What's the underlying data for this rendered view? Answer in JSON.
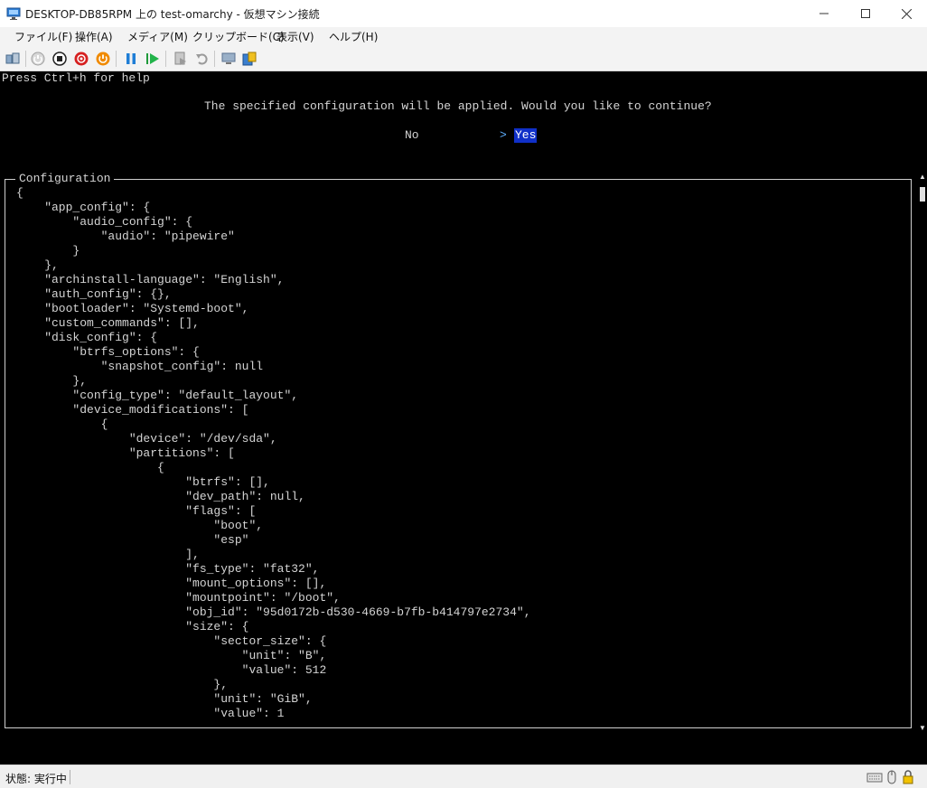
{
  "window": {
    "title": "DESKTOP-DB85RPM 上の test-omarchy  - 仮想マシン接続",
    "minimize_icon": "minimize-icon",
    "maximize_icon": "maximize-icon",
    "close_icon": "close-icon"
  },
  "menu": {
    "items": [
      "ファイル(F)",
      "操作(A)",
      "メディア(M)",
      "クリップボード(C)",
      "表示(V)",
      "ヘルプ(H)"
    ]
  },
  "toolbar": {
    "icons": [
      "ctrl-alt-del-icon",
      "start-icon",
      "turn-off-icon",
      "shutdown-icon",
      "save-icon",
      "pause-icon",
      "resume-icon",
      "checkpoint-icon",
      "revert-icon",
      "enhanced-session-icon",
      "share-icon"
    ]
  },
  "terminal": {
    "help": "Press Ctrl+h for help",
    "question": "The specified configuration will be applied. Would you like to continue?",
    "option_no": "No",
    "option_arrow": ">",
    "option_yes": "Yes",
    "frame_title": "Configuration",
    "config_lines": [
      "{",
      "    \"app_config\": {",
      "        \"audio_config\": {",
      "            \"audio\": \"pipewire\"",
      "        }",
      "    },",
      "    \"archinstall-language\": \"English\",",
      "    \"auth_config\": {},",
      "    \"bootloader\": \"Systemd-boot\",",
      "    \"custom_commands\": [],",
      "    \"disk_config\": {",
      "        \"btrfs_options\": {",
      "            \"snapshot_config\": null",
      "        },",
      "        \"config_type\": \"default_layout\",",
      "        \"device_modifications\": [",
      "            {",
      "                \"device\": \"/dev/sda\",",
      "                \"partitions\": [",
      "                    {",
      "                        \"btrfs\": [],",
      "                        \"dev_path\": null,",
      "                        \"flags\": [",
      "                            \"boot\",",
      "                            \"esp\"",
      "                        ],",
      "                        \"fs_type\": \"fat32\",",
      "                        \"mount_options\": [],",
      "                        \"mountpoint\": \"/boot\",",
      "                        \"obj_id\": \"95d0172b-d530-4669-b7fb-b414797e2734\",",
      "                        \"size\": {",
      "                            \"sector_size\": {",
      "                                \"unit\": \"B\",",
      "                                \"value\": 512",
      "                            },",
      "                            \"unit\": \"GiB\",",
      "                            \"value\": 1"
    ]
  },
  "status": {
    "text": "状態: 実行中",
    "icons": [
      "keyboard-icon",
      "mouse-icon",
      "lock-icon"
    ]
  }
}
